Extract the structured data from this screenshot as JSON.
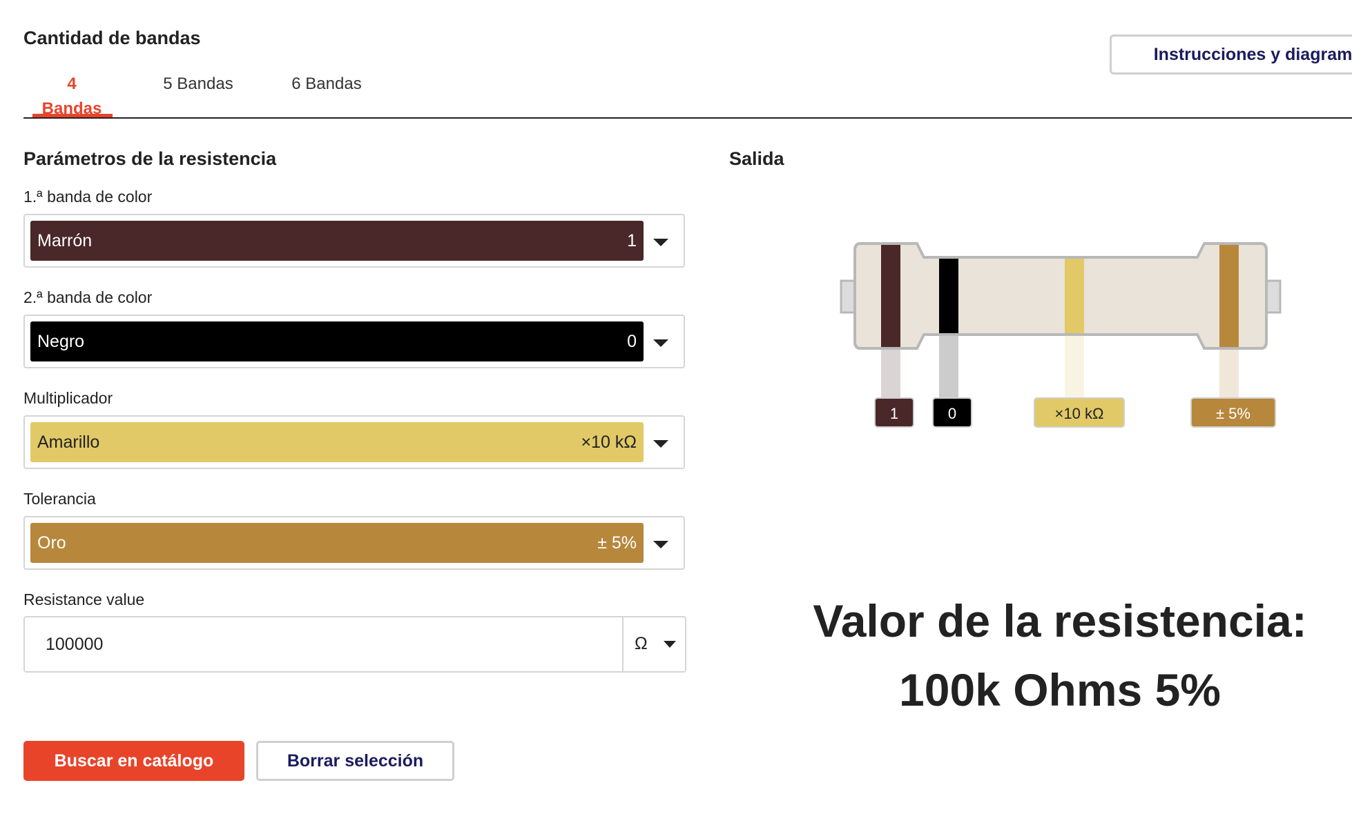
{
  "band_count": {
    "title": "Cantidad de bandas",
    "tabs": [
      {
        "label": "4 Bandas",
        "active": true
      },
      {
        "label": "5 Bandas",
        "active": false
      },
      {
        "label": "6 Bandas",
        "active": false
      }
    ]
  },
  "header": {
    "instructions_label": "Instrucciones y diagrama"
  },
  "params": {
    "title": "Parámetros de la resistencia",
    "bands": [
      {
        "label": "1.ª banda de color",
        "color_name": "Marrón",
        "value": "1",
        "color": "#4a2728",
        "text_color": "#ffffff"
      },
      {
        "label": "2.ª banda de color",
        "color_name": "Negro",
        "value": "0",
        "color": "#000000",
        "text_color": "#ffffff"
      },
      {
        "label": "Multiplicador",
        "color_name": "Amarillo",
        "value": "×10 kΩ",
        "color": "#e1c967",
        "text_color": "#222222"
      },
      {
        "label": "Tolerancia",
        "color_name": "Oro",
        "value": "± 5%",
        "color": "#b7873c",
        "text_color": "#ffffff"
      }
    ],
    "resistance_label": "Resistance value",
    "resistance_value": "100000",
    "unit": "Ω"
  },
  "output": {
    "title": "Salida",
    "tags": [
      {
        "text": "1",
        "color": "#4a2728",
        "text_color": "#ffffff"
      },
      {
        "text": "0",
        "color": "#000000",
        "text_color": "#ffffff"
      },
      {
        "text": "×10 kΩ",
        "color": "#e1c967",
        "text_color": "#222222"
      },
      {
        "text": "± 5%",
        "color": "#b7873c",
        "text_color": "#ffffff"
      }
    ],
    "result_line1": "Valor de la resistencia:",
    "result_line2": "100k Ohms 5%"
  },
  "actions": {
    "search_label": "Buscar en catálogo",
    "clear_label": "Borrar selección"
  },
  "colors": {
    "accent": "#e8442a",
    "navy": "#1b1b5e",
    "resistor_body": "#e9e3d9",
    "resistor_outline": "#b8b8b8"
  }
}
